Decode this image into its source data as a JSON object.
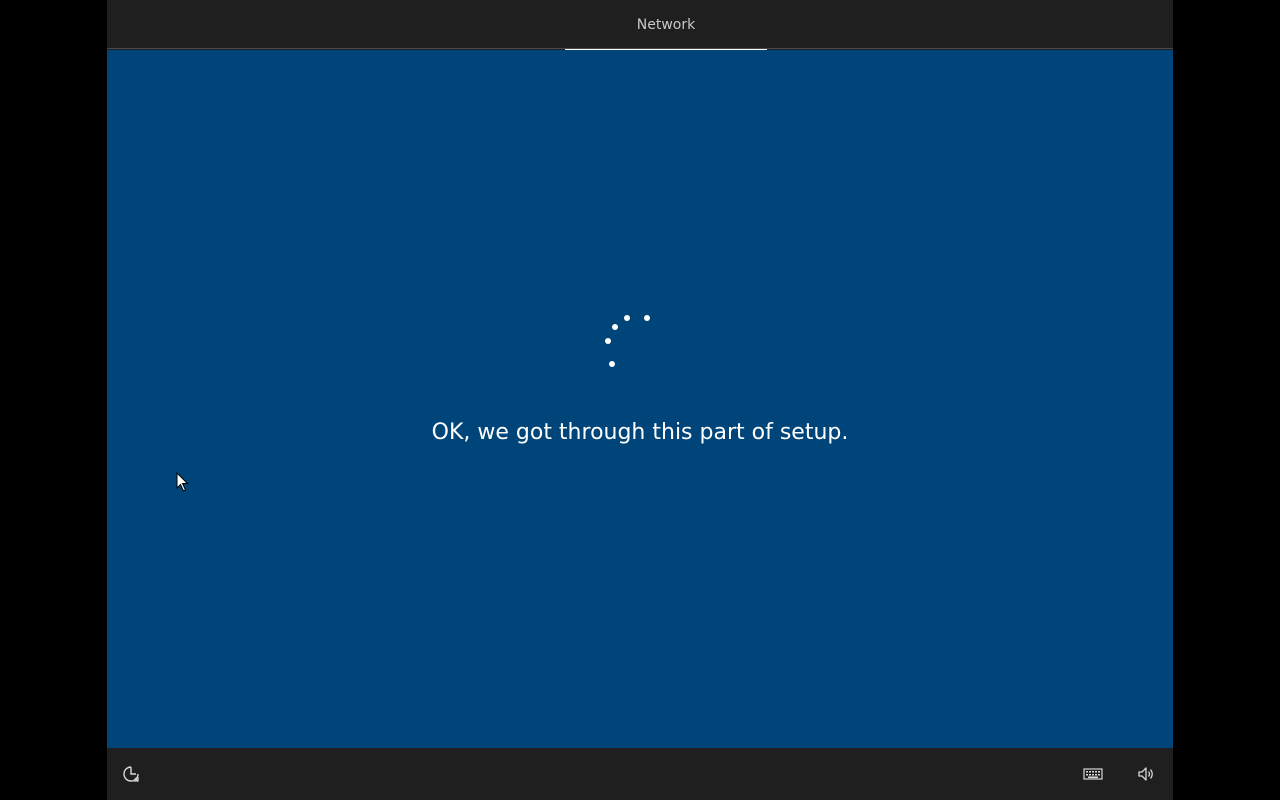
{
  "header": {
    "active_section": "Network"
  },
  "main": {
    "status_message": "OK, we got through this part of setup.",
    "spinner_icon": "loading-spinner-icon"
  },
  "footer": {
    "icons": [
      "ease-of-access-icon",
      "keyboard-icon",
      "volume-icon"
    ]
  },
  "colors": {
    "panel_background": "#00457a",
    "bar_background": "#1f1f1f",
    "text": "#ffffff"
  }
}
